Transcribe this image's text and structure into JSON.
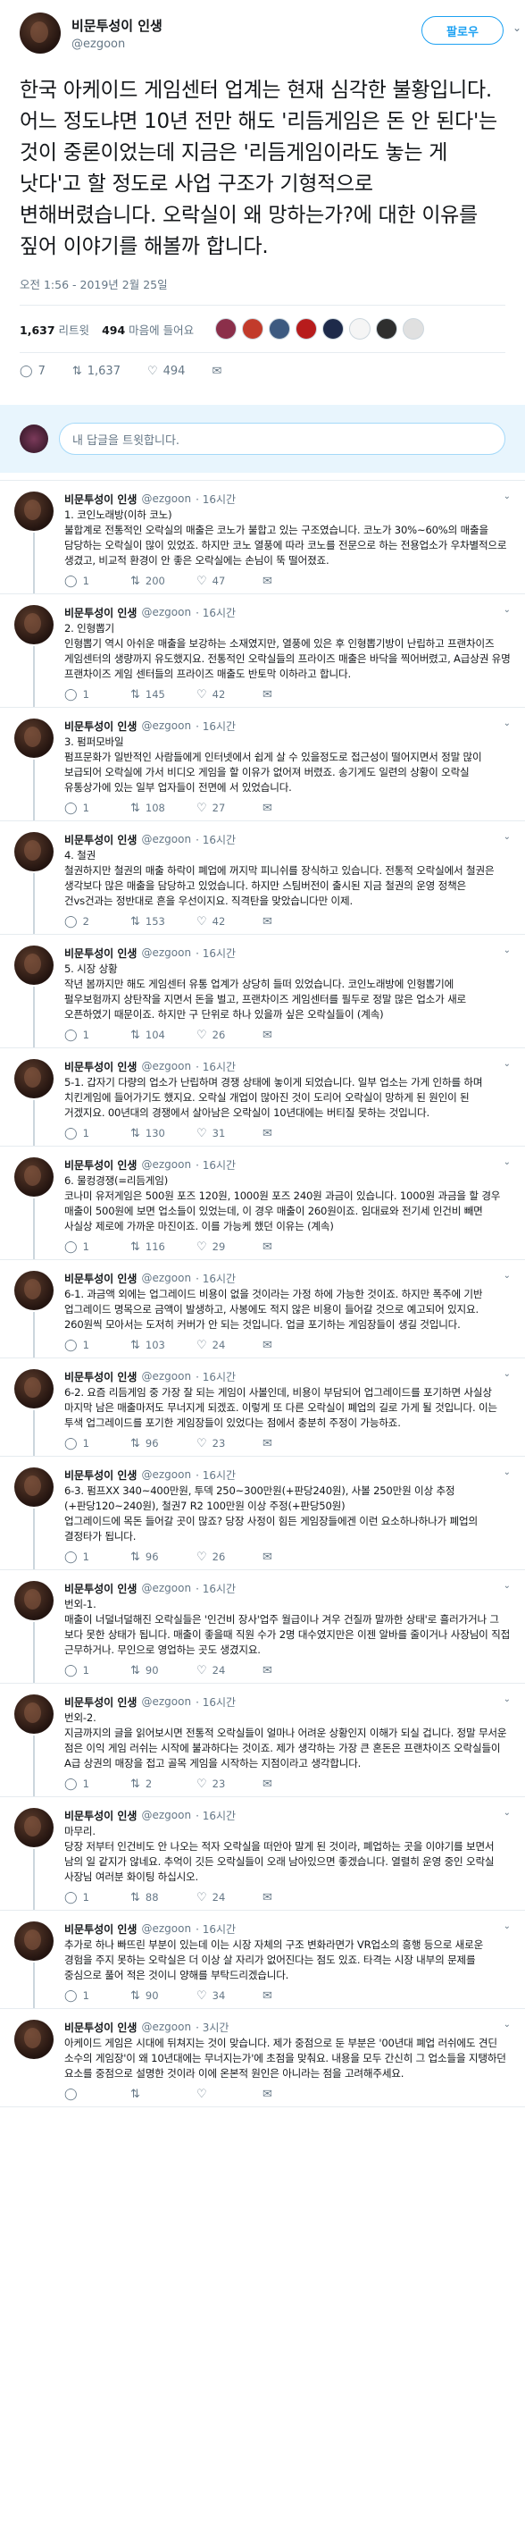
{
  "main_tweet": {
    "author_name": "비문투성이 인생",
    "author_handle": "@ezgoon",
    "follow_label": "팔로우",
    "text": "한국 아케이드 게임센터 업계는 현재 심각한 불황입니다. 어느 정도냐면 10년 전만 해도 '리듬게임은 돈 안 된다'는 것이 중론이었는데 지금은 '리듬게임이라도 놓는 게 낫다'고 할 정도로 사업 구조가 기형적으로 변해버렸습니다. 오락실이 왜 망하는가?에 대한 이유를 짚어 이야기를 해볼까 합니다.",
    "timestamp": "오전 1:56 - 2019년 2월 25일",
    "retweets_count": "1,637",
    "retweets_label": "리트윗",
    "likes_count": "494",
    "likes_label": "마음에 들어요",
    "likers": [
      "#8b2f4a",
      "#c23b2b",
      "#3d5a80",
      "#b71c1c",
      "#1e2a4a",
      "#f5f5f5",
      "#2e2e2e",
      "#e0e0e0"
    ],
    "reply_count": "7",
    "retweet_action_count": "1,637",
    "like_action_count": "494",
    "reply_placeholder": "내 답글을 트윗합니다."
  },
  "icons": {
    "reply": "speech-bubble-icon",
    "retweet": "retweet-arrows-icon",
    "like": "heart-icon",
    "dm": "envelope-icon",
    "more": "chevron-down-icon"
  },
  "thread": [
    {
      "name": "비문투성이 인생",
      "handle": "@ezgoon",
      "time": "· 16시간",
      "text": "1. 코인노래방(이하 코노)\n불합계로 전통적인 오락실의 매출은 코노가 불합고 있는 구조였습니다. 코노가 30%~60%의 매출을 담당하는 오락실이 많이 있었죠. 하지만 코노 열풍에 따라 코노를 전문으로 하는 전용업소가 우차별적으로 생겼고, 비교적 환경이 안 좋은 오락실에는 손님이 뚝 떨어졌죠.",
      "replies": "1",
      "retweets": "200",
      "likes": "47"
    },
    {
      "name": "비문투성이 인생",
      "handle": "@ezgoon",
      "time": "· 16시간",
      "text": "2. 인형뽑기\n인형뽑기 역시 아쉬운 매출을 보강하는 소재였지만, 열풍에 있은 후 인형뽑기방이 난립하고 프랜차이즈 게임센터의 생량까지 유도했지요. 전통적인 오락실들의 프라이즈 매출은 바닥을 찍어버렸고, A급상권 유명 프랜차이즈 게임 센터들의 프라이즈 매출도 반토막 이하라고 합니다.",
      "replies": "1",
      "retweets": "145",
      "likes": "42"
    },
    {
      "name": "비문투성이 인생",
      "handle": "@ezgoon",
      "time": "· 16시간",
      "text": "3. 펌퍼모바일\n펌프문화가 일반적인 사람들에게 인터넷에서 쉽게 살 수 있을정도로 접근성이 떨어지면서 정말 많이 보급되어 오락실에 가서 비디오 게임을 할 이유가 없어져 버렸죠. 송기게도 일련의 상황이 오락실 유통상가에 있는 일부 업자들이 전면에 서 있었습니다.",
      "replies": "1",
      "retweets": "108",
      "likes": "27"
    },
    {
      "name": "비문투성이 인생",
      "handle": "@ezgoon",
      "time": "· 16시간",
      "text": "4. 철권\n철권하지만 철권의 매출 하락이 폐업에 꺼지막 피니쉬를 장식하고 있습니다. 전통적 오락실에서 철권은 생각보다 많은 매출을 담당하고 있었습니다. 하지만 스팀버전이 출시된 지금 철권의 운영 정책은 건vs건과는 정반대로 흔을 우선이지요. 직격탄을 맞았습니다만 이제.",
      "replies": "2",
      "retweets": "153",
      "likes": "42"
    },
    {
      "name": "비문투성이 인생",
      "handle": "@ezgoon",
      "time": "· 16시간",
      "text": "5. 시장 상황\n작년 봄까지만 해도 게임센터 유통 업계가 상당히 들떠 있었습니다. 코인노래방에 인형뽑기에 펄우보험까지 상탄작을 지면서 돈을 벌고, 프랜차이즈 게임센터를 필두로 정말 많은 업소가 새로 오픈하였기 때문이죠. 하지만 구 단위로 하나 있을까 싶은 오락실들이 (계속)",
      "replies": "1",
      "retweets": "104",
      "likes": "26"
    },
    {
      "name": "비문투성이 인생",
      "handle": "@ezgoon",
      "time": "· 16시간",
      "text": "5-1. 갑자기 다량의 업소가 난립하며 경쟁 상태에 놓이게 되었습니다. 일부 업소는 가게 인하를 하며 치킨게임에 들어가기도 했지요. 오락실 개업이 많아진 것이 도리어 오락실이 망하게 된 원인이 된 거겠지요. 00년대의 경쟁에서 살아남은 오락실이 10년대에는 버티질 못하는 것입니다.",
      "replies": "1",
      "retweets": "130",
      "likes": "31"
    },
    {
      "name": "비문투성이 인생",
      "handle": "@ezgoon",
      "time": "· 16시간",
      "text": "6. 물컹경쟁(=리듬게임)\n코나미 유저게임은 500원 포즈 120원, 1000원 포즈 240원 과금이 있습니다. 1000원 과금을 할 경우 매출이 500원에 보면 업소들이 있었는데, 이 경우 매출이 260원이죠. 임대료와 전기세 인건비 빼면 사실상 제로에 가까운 마진이죠. 이를 가능케 했던 이유는 (계속)",
      "replies": "1",
      "retweets": "116",
      "likes": "29"
    },
    {
      "name": "비문투성이 인생",
      "handle": "@ezgoon",
      "time": "· 16시간",
      "text": "6-1. 과금액 외에는 업그레이드 비용이 없을 것이라는 가정 하에 가능한 것이죠. 하지만 폭주에 기반 업그레이드 명목으로 금액이 발생하고, 사봉에도 적지 않은 비용이 들어갈 것으로 예고되어 있지요. 260원씩 모아서는 도저히 커버가 안 되는 것입니다. 업글 포기하는 게임장들이 생길 것입니다.",
      "replies": "1",
      "retweets": "103",
      "likes": "24"
    },
    {
      "name": "비문투성이 인생",
      "handle": "@ezgoon",
      "time": "· 16시간",
      "text": "6-2. 요즘 리듬게임 중 가장 잘 되는 게임이 사볼인데, 비용이 부담되어 업그레이드를 포기하면 사실상 마지막 남은 매출마저도 무너지게 되겠죠. 이렇게 또 다른 오락실이 폐업의 길로 가게 될 것입니다. 이는 투색 업그레이드를 포기한 게임장들이 있었다는 점에서 충분히 주정이 가능하죠.",
      "replies": "1",
      "retweets": "96",
      "likes": "23"
    },
    {
      "name": "비문투성이 인생",
      "handle": "@ezgoon",
      "time": "· 16시간",
      "text": "6-3. 펌프XX 340~400만원, 투덱 250~300만원(+판당240원), 사볼 250만원 이상 추정(+판당120~240원), 철권7 R2 100만원 이상 주정(+판당50원)\n업그레이드에 목돈 들어갈 곳이 많죠? 당장 사정이 힘든 게임장들에겐 이런 요소하나하나가 폐업의 결정타가 됩니다.",
      "replies": "1",
      "retweets": "96",
      "likes": "26"
    },
    {
      "name": "비문투성이 인생",
      "handle": "@ezgoon",
      "time": "· 16시간",
      "text": "번외-1.\n매출이 너덜너덜해진 오락실들은 '인건비 장사'업주 월급이나 겨우 건질까 말까한 상태'로 흘러가거나 그 보다 못한 상태가 됩니다. 매출이 좋을때 직원 수가 2명 대수였지만은 이젠 알바를 줄이거나 사장님이 직접 근무하거나. 무인으로 영업하는 곳도 생겼지요.",
      "replies": "1",
      "retweets": "90",
      "likes": "24"
    },
    {
      "name": "비문투성이 인생",
      "handle": "@ezgoon",
      "time": "· 16시간",
      "text": "번외-2.\n지금까지의 글을 읽어보시면 전통적 오락실들이 얼마나 어려운 상황인지 이해가 되실 겁니다. 정말 무서운 점은 이익 게임 러쉬는 시작에 불과하다는 것이죠. 제가 생각하는 가장 큰 혼돈은 프랜차이즈 오락실들이 A급 상권의 매장을 접고 골목 게임을 시작하는 지점이라고 생각합니다.",
      "replies": "1",
      "retweets": "2",
      "likes": "23"
    },
    {
      "name": "비문투성이 인생",
      "handle": "@ezgoon",
      "time": "· 16시간",
      "text": "마무리.\n당장 저부터 인건비도 안 나오는 적자 오락실을 떠안아 말게 된 것이라, 폐업하는 곳을 이야기를 보면서 남의 일 같지가 않네요. 추억이 깃든 오락실들이 오래 남아있으면 좋겠습니다. 열렬히 운영 중인 오락실 사장님 여러분 화이팅 하십시오.",
      "replies": "1",
      "retweets": "88",
      "likes": "24"
    },
    {
      "name": "비문투성이 인생",
      "handle": "@ezgoon",
      "time": "· 16시간",
      "text": "추가로 하나 빠뜨린 부분이 있는데 이는 시장 자체의 구조 변화라면가 VR업소의 흥행 등으로 새로운 경험을 주지 못하는 오락실은 더 이상 살 자리가 없어진다는 점도 있죠. 타격는 시장 내부의 문제를 중심으로 풀어 적은 것이니 양해를 부탁드리겠습니다.",
      "replies": "1",
      "retweets": "90",
      "likes": "34"
    },
    {
      "name": "비문투성이 인생",
      "handle": "@ezgoon",
      "time": "· 3시간",
      "text": "아케이드 게임은 시대에 뒤쳐지는 것이 맞습니다. 제가 중점으로 둔 부분은 '00년대 폐업 러쉬에도 견딘 소수의 게임장'이 왜 10년대에는 무너지는가'에 초점을 맞춰요. 내용을 모두 간신히 그 업소들을 지탱하던 요소를 중점으로 설명한 것이라 이에 온본적 원인은 아니라는 점을 고려해주세요.",
      "replies": "",
      "retweets": "",
      "likes": ""
    }
  ]
}
